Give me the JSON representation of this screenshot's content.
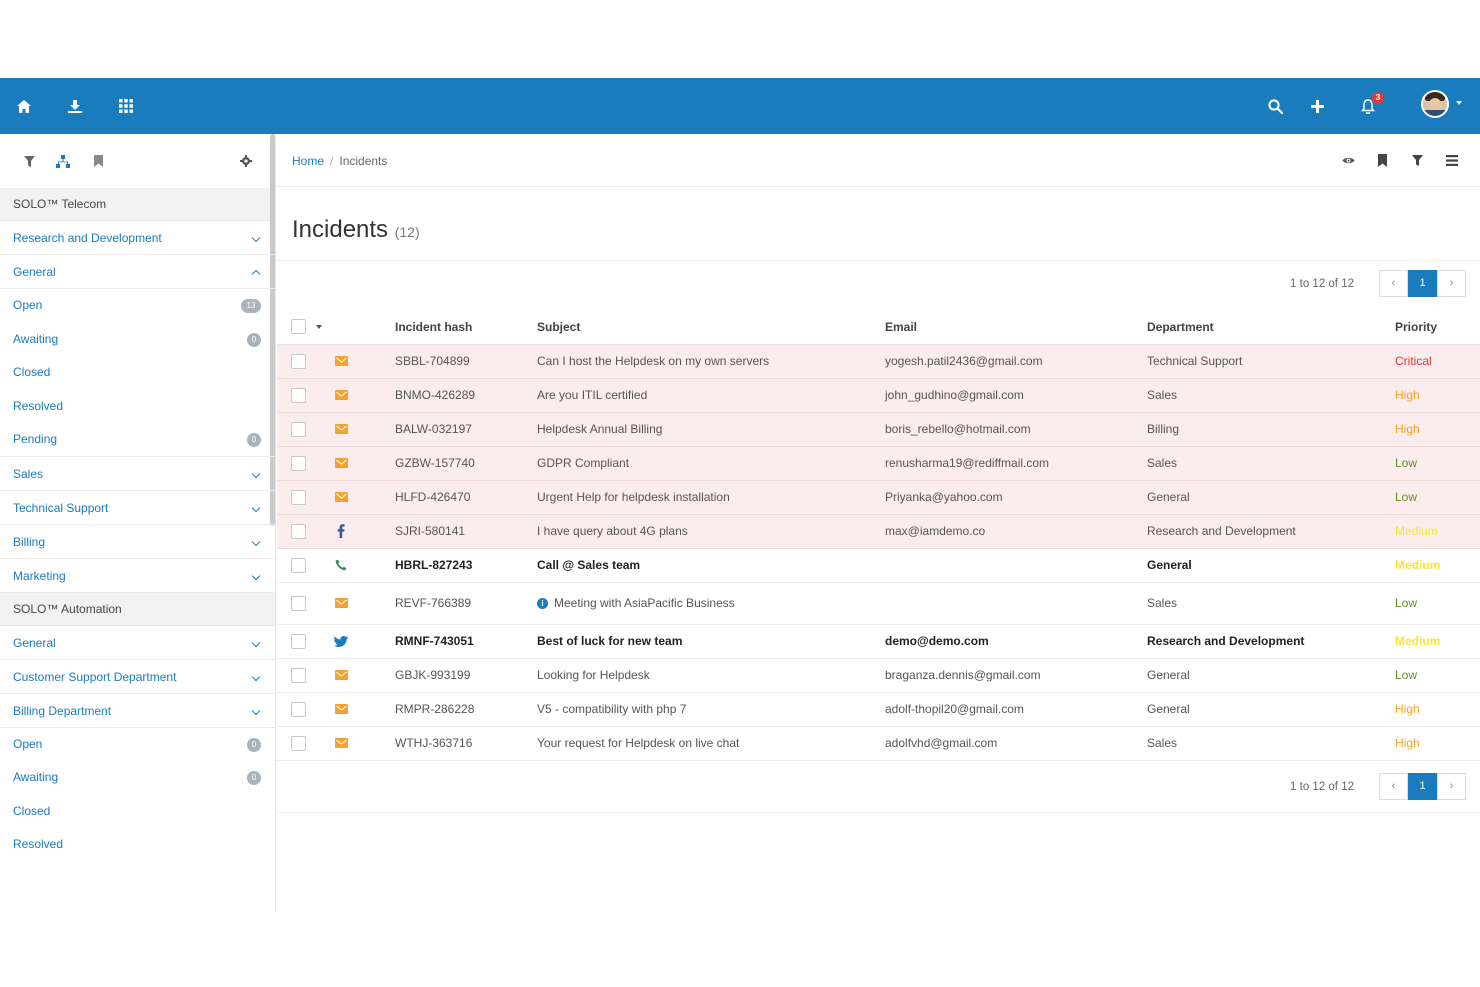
{
  "colors": {
    "brand": "#1a7bbd",
    "critical": "#e53935",
    "high": "#f5a623",
    "low": "#5f8f1e",
    "medium": "#f7e43c",
    "email": "#f0a233",
    "facebook": "#3b5998",
    "phone": "#2e8b57",
    "twitter": "#1a7bbd"
  },
  "topbar": {
    "icons": [
      "home-icon",
      "download-icon",
      "apps-grid-icon",
      "search-icon",
      "plus-icon",
      "bell-icon"
    ],
    "notification_count": "3"
  },
  "sidebar": {
    "tools": [
      "filter-icon",
      "hierarchy-icon",
      "bookmark-icon",
      "gear-icon"
    ],
    "groups": [
      {
        "label": "SOLO™ Telecom",
        "items": [
          {
            "label": "Research and Development",
            "chevron": "down"
          },
          {
            "label": "General",
            "chevron": "up",
            "children": [
              {
                "label": "Open",
                "count": "13"
              },
              {
                "label": "Awaiting",
                "count": "0"
              },
              {
                "label": "Closed"
              },
              {
                "label": "Resolved"
              },
              {
                "label": "Pending",
                "count": "0"
              }
            ]
          },
          {
            "label": "Sales",
            "chevron": "down"
          },
          {
            "label": "Technical Support",
            "chevron": "down"
          },
          {
            "label": "Billing",
            "chevron": "down"
          },
          {
            "label": "Marketing",
            "chevron": "down"
          }
        ]
      },
      {
        "label": "SOLO™ Automation",
        "items": [
          {
            "label": "General",
            "chevron": "down"
          },
          {
            "label": "Customer Support Department",
            "chevron": "down"
          },
          {
            "label": "Billing Department",
            "chevron": "down",
            "children": [
              {
                "label": "Open",
                "count": "0"
              },
              {
                "label": "Awaiting",
                "count": "0"
              },
              {
                "label": "Closed"
              },
              {
                "label": "Resolved"
              }
            ]
          }
        ]
      }
    ]
  },
  "breadcrumb": {
    "home": "Home",
    "separator": "/",
    "current": "Incidents"
  },
  "header_tools": [
    "eye-icon",
    "bookmark-icon",
    "filter-icon",
    "menu-icon"
  ],
  "page": {
    "title": "Incidents",
    "count": "(12)"
  },
  "pagination": {
    "info": "1 to 12 of 12",
    "prev": "‹",
    "page": "1",
    "next": "›"
  },
  "table": {
    "columns": {
      "hash": "Incident hash",
      "subject": "Subject",
      "email": "Email",
      "department": "Department",
      "priority": "Priority"
    },
    "rows": [
      {
        "channel": "email",
        "hash": "SBBL-704899",
        "subject": "Can I host the Helpdesk on my own servers",
        "email": "yogesh.patil2436@gmail.com",
        "department": "Technical Support",
        "priority": "Critical",
        "highlight": true
      },
      {
        "channel": "email",
        "hash": "BNMO-426289",
        "subject": "Are you ITIL certified",
        "email": "john_gudhino@gmail.com",
        "department": "Sales",
        "priority": "High",
        "highlight": true
      },
      {
        "channel": "email",
        "hash": "BALW-032197",
        "subject": "Helpdesk Annual Billing",
        "email": "boris_rebello@hotmail.com",
        "department": "Billing",
        "priority": "High",
        "highlight": true
      },
      {
        "channel": "email",
        "hash": "GZBW-157740",
        "subject": "GDPR Compliant",
        "email": "renusharma19@rediffmail.com",
        "department": "Sales",
        "priority": "Low",
        "highlight": true
      },
      {
        "channel": "email",
        "hash": "HLFD-426470",
        "subject": "Urgent Help for helpdesk installation",
        "email": "Priyanka@yahoo.com",
        "department": "General",
        "priority": "Low",
        "highlight": true
      },
      {
        "channel": "facebook",
        "hash": "SJRI-580141",
        "subject": "I have query about 4G plans",
        "email": "max@iamdemo.co",
        "department": "Research and Development",
        "priority": "Medium",
        "highlight": true
      },
      {
        "channel": "phone",
        "hash": "HBRL-827243",
        "subject": "Call @ Sales team",
        "email": "",
        "department": "General",
        "priority": "Medium",
        "bold": true
      },
      {
        "channel": "email",
        "hash": "REVF-766389",
        "subject": "Meeting with AsiaPacific Business",
        "email": "",
        "department": "Sales",
        "priority": "Low",
        "info": true
      },
      {
        "channel": "twitter",
        "hash": "RMNF-743051",
        "subject": "Best of luck for new team",
        "email": "demo@demo.com",
        "department": "Research and Development",
        "priority": "Medium",
        "bold": true
      },
      {
        "channel": "email",
        "hash": "GBJK-993199",
        "subject": "Looking for Helpdesk",
        "email": "braganza.dennis@gmail.com",
        "department": "General",
        "priority": "Low"
      },
      {
        "channel": "email",
        "hash": "RMPR-286228",
        "subject": "V5 - compatibility with php 7",
        "email": "adolf-thopil20@gmail.com",
        "department": "General",
        "priority": "High"
      },
      {
        "channel": "email",
        "hash": "WTHJ-363716",
        "subject": "Your request for Helpdesk on live chat",
        "email": "adolfvhd@gmail.com",
        "department": "Sales",
        "priority": "High"
      }
    ]
  }
}
